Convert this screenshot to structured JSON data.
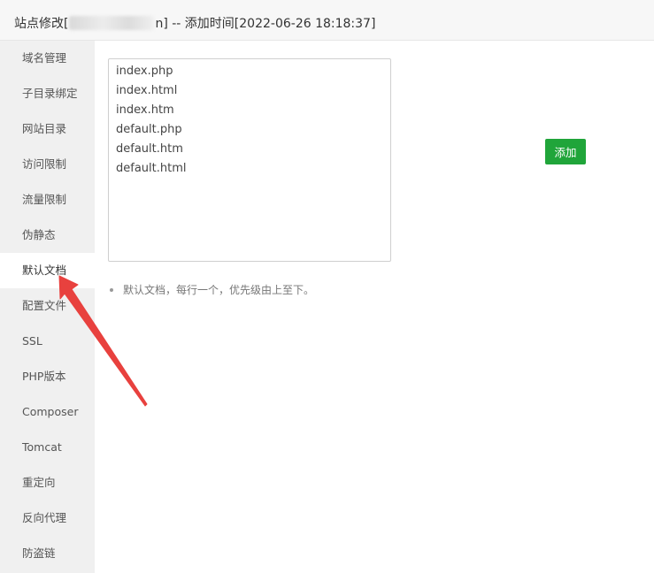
{
  "title_bar": {
    "prefix": "站点修改[",
    "suffix": "n] -- 添加时间[2022-06-26 18:18:37]"
  },
  "sidebar": {
    "items": [
      {
        "label": "域名管理"
      },
      {
        "label": "子目录绑定"
      },
      {
        "label": "网站目录"
      },
      {
        "label": "访问限制"
      },
      {
        "label": "流量限制"
      },
      {
        "label": "伪静态"
      },
      {
        "label": "默认文档",
        "active": true
      },
      {
        "label": "配置文件"
      },
      {
        "label": "SSL"
      },
      {
        "label": "PHP版本"
      },
      {
        "label": "Composer"
      },
      {
        "label": "Tomcat"
      },
      {
        "label": "重定向"
      },
      {
        "label": "反向代理"
      },
      {
        "label": "防盗链"
      }
    ]
  },
  "default_docs": {
    "value": "index.php\nindex.html\nindex.htm\ndefault.php\ndefault.htm\ndefault.html"
  },
  "add_button": {
    "label": "添加"
  },
  "tip": {
    "text": "默认文档，每行一个，优先级由上至下。"
  },
  "colors": {
    "accent": "#20a53a",
    "annotation_arrow": "#e8413e"
  }
}
